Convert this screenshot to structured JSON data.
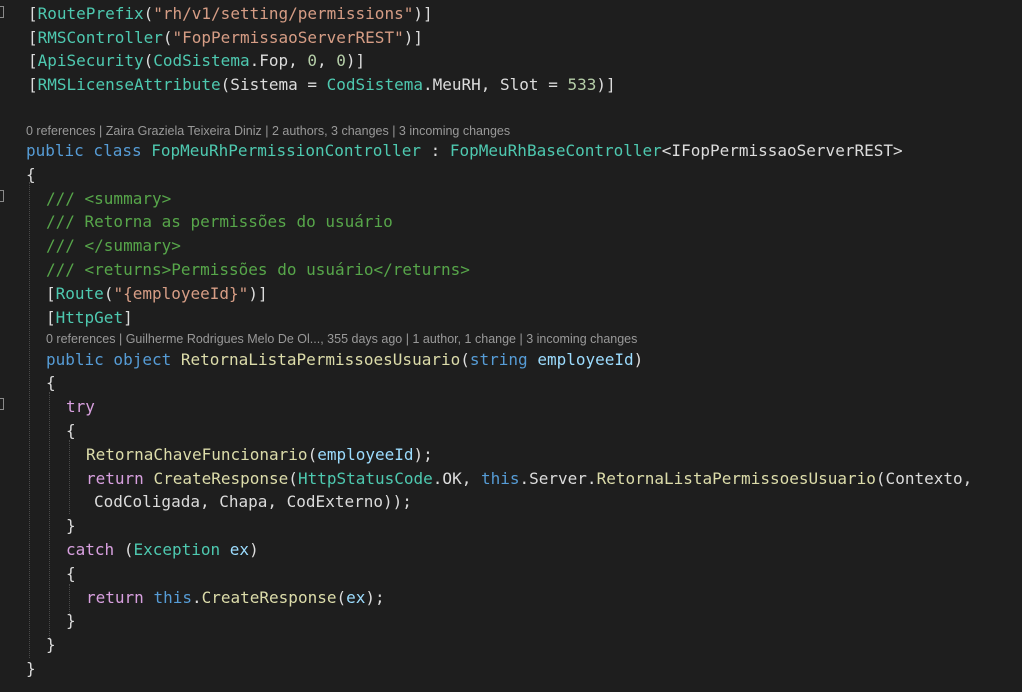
{
  "attributes": {
    "route_prefix": "[RoutePrefix(\"rh/v1/setting/permissions\")]",
    "rms_controller": "[RMSController(\"FopPermissaoServerREST\")]",
    "api_security": "[ApiSecurity(CodSistema.Fop, 0, 0)]",
    "license": "[RMSLicenseAttribute(Sistema = CodSistema.MeuRH, Slot = 533)]"
  },
  "class_lens": {
    "references": "0 references",
    "author": "Zaira Graziela Teixeira Diniz",
    "authors_changes": "2 authors, 3 changes",
    "incoming": "3 incoming changes"
  },
  "class_decl": {
    "modifiers": "public class",
    "name": "FopMeuRhPermissionController",
    "colon": ":",
    "base": "FopMeuRhBaseController",
    "generic": "<IFopPermissaoServerREST>"
  },
  "doc": {
    "summary_open": "/// <summary>",
    "summary_text": "/// Retorna as permissões do usuário",
    "summary_close": "/// </summary>",
    "returns": "/// <returns>Permissões do usuário</returns>"
  },
  "method_attrs": {
    "route": "[Route(\"{employeeId}\")]",
    "http_get": "[HttpGet]"
  },
  "method_lens": {
    "references": "0 references",
    "author": "Guilherme Rodrigues Melo De Ol...,",
    "age": "355 days ago",
    "authors_changes": "1 author, 1 change",
    "incoming": "3 incoming changes"
  },
  "method_decl": {
    "modifiers": "public object",
    "name": "RetornaListaPermissoesUsuario",
    "param_type": "string",
    "param_name": "employeeId"
  },
  "body": {
    "try": "try",
    "call1_name": "RetornaChaveFuncionario",
    "call1_arg": "employeeId",
    "return_kw": "return",
    "create_response": "CreateResponse",
    "status_type": "HttpStatusCode",
    "status_value": ".OK, ",
    "this_kw": "this",
    "server": ".Server.",
    "server_method": "RetornaListaPermissoesUsuario",
    "args_line1": "(Contexto,",
    "args_line2": "CodColigada, Chapa, CodExterno));",
    "catch_kw": "catch",
    "exception_type": "Exception",
    "exception_var": "ex",
    "return2_arg": "ex"
  },
  "colors": {
    "background": "#1e1e1e",
    "keyword": "#569cd6",
    "type": "#4ec9b0",
    "string": "#d69d85",
    "number": "#b5cea8",
    "method": "#dcdcaa",
    "parameter": "#9cdcfe",
    "comment": "#57a64a",
    "control": "#d8a0df",
    "plain": "#dcdcdc",
    "codelens": "#999999"
  }
}
